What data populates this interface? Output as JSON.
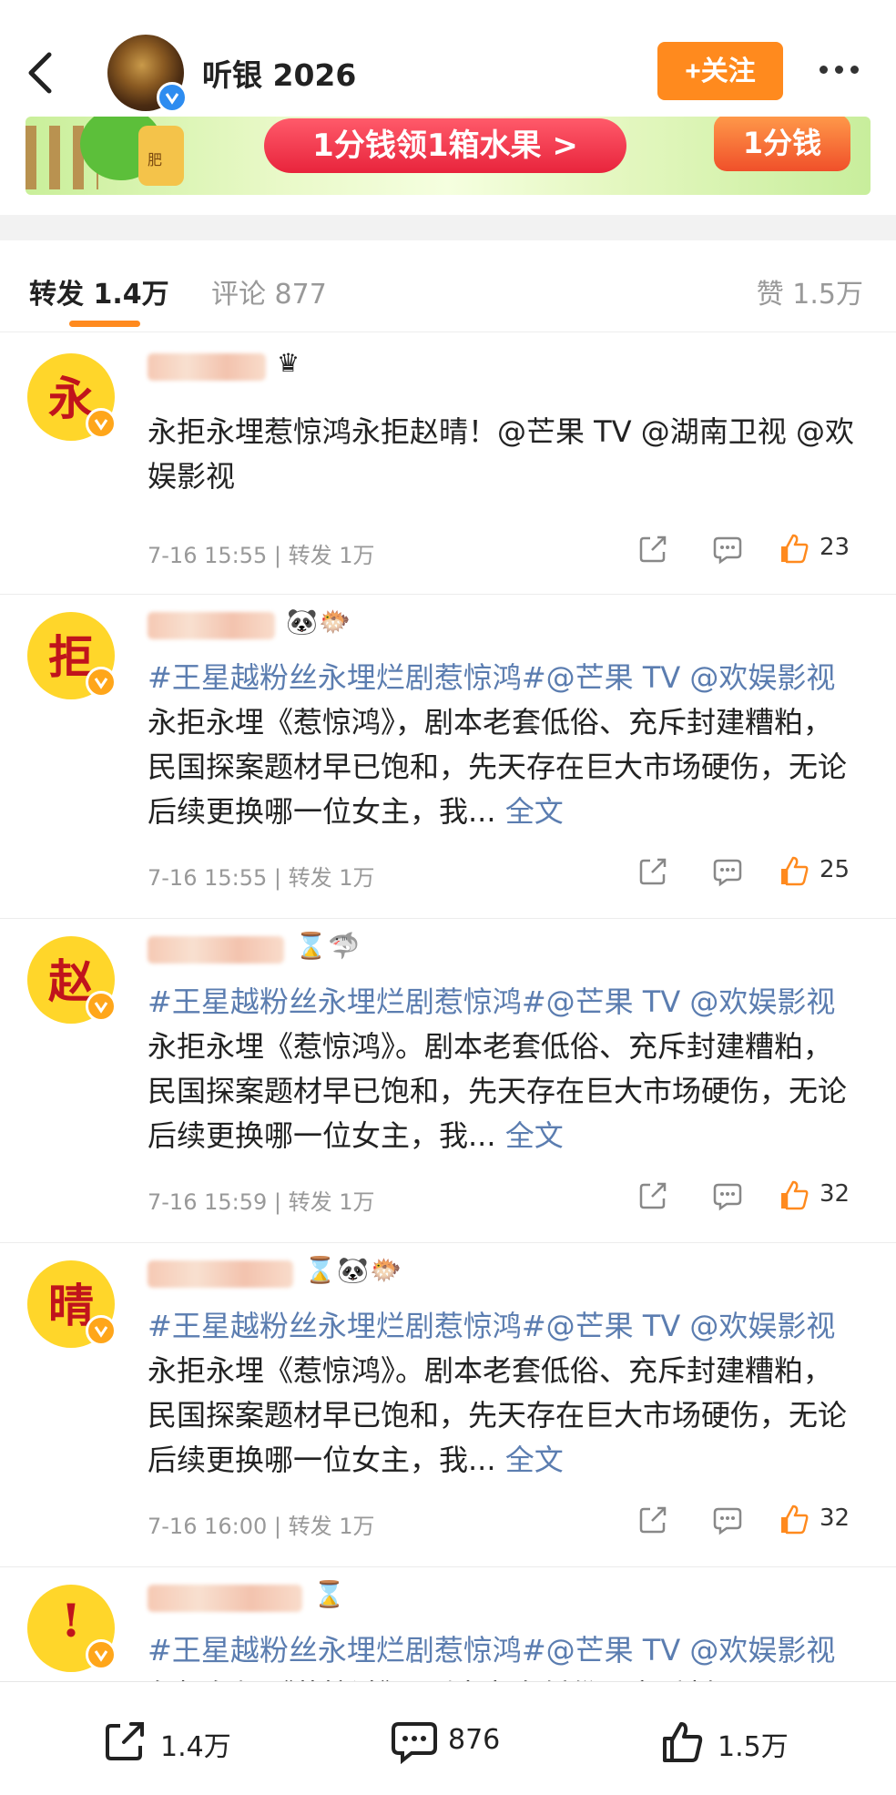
{
  "header": {
    "username": "听银 2026",
    "follow_label": "+关注"
  },
  "banner": {
    "promo_text": "1分钱领1箱水果 >",
    "right_button": "1分钱",
    "jar_label": "肥"
  },
  "tabs": {
    "repost": "转发 1.4万",
    "comment": "评论 877",
    "like": "赞 1.5万"
  },
  "feed": [
    {
      "avatar_char": "永",
      "segments": [
        {
          "t": "永拒永埋惹惊鸿永拒赵晴！@芒果 TV @湖南卫视 @欢娱影视",
          "c": ""
        }
      ],
      "timestamp": "7-16 15:55",
      "reposts": "转发 1万",
      "likes": "23"
    },
    {
      "avatar_char": "拒",
      "segments": [
        {
          "t": "#王星越粉丝永埋烂剧惹惊鸿#",
          "c": "tag"
        },
        {
          "t": "@芒果 TV @欢娱影视",
          "c": "tag"
        },
        {
          "t": "永拒永埋《惹惊鸿》，剧本老套低俗、充斥封建糟粕，民国探案题材早已饱和，先天存在巨大市场硬伤，无论后续更换哪一位女主，我...",
          "c": ""
        },
        {
          "t": " 全文",
          "c": "more-link"
        }
      ],
      "timestamp": "7-16 15:55",
      "reposts": "转发 1万",
      "likes": "25"
    },
    {
      "avatar_char": "赵",
      "segments": [
        {
          "t": "#王星越粉丝永埋烂剧惹惊鸿#",
          "c": "tag"
        },
        {
          "t": "@芒果 TV @欢娱影视",
          "c": "tag"
        },
        {
          "t": "永拒永埋《惹惊鸿》。剧本老套低俗、充斥封建糟粕，民国探案题材早已饱和，先天存在巨大市场硬伤，无论后续更换哪一位女主，我...",
          "c": ""
        },
        {
          "t": " 全文",
          "c": "more-link"
        }
      ],
      "timestamp": "7-16 15:59",
      "reposts": "转发 1万",
      "likes": "32"
    },
    {
      "avatar_char": "晴",
      "segments": [
        {
          "t": "#王星越粉丝永埋烂剧惹惊鸿#",
          "c": "tag"
        },
        {
          "t": "@芒果 TV @欢娱影视",
          "c": "tag"
        },
        {
          "t": "永拒永埋《惹惊鸿》。剧本老套低俗、充斥封建糟粕，民国探案题材早已饱和，先天存在巨大市场硬伤，无论后续更换哪一位女主，我...",
          "c": ""
        },
        {
          "t": " 全文",
          "c": "more-link"
        }
      ],
      "timestamp": "7-16 16:00",
      "reposts": "转发 1万",
      "likes": "32"
    },
    {
      "avatar_char": "!",
      "segments": [
        {
          "t": "#王星越粉丝永埋烂剧惹惊鸿#",
          "c": "tag"
        },
        {
          "t": "@芒果 TV @欢娱影视",
          "c": "tag"
        },
        {
          "t": "永拒永埋《惹惊鸿》。剧本老套低俗，充斥封",
          "c": ""
        }
      ],
      "timestamp": "",
      "reposts": "",
      "likes": ""
    }
  ],
  "bottom_bar": {
    "share_count": "1.4万",
    "comment_count": "876",
    "like_count": "1.5万"
  },
  "colors": {
    "accent": "#ff8a1e",
    "link": "#5b7db0",
    "avatar_bg": "#ffd62a",
    "avatar_char": "#c0141c"
  }
}
